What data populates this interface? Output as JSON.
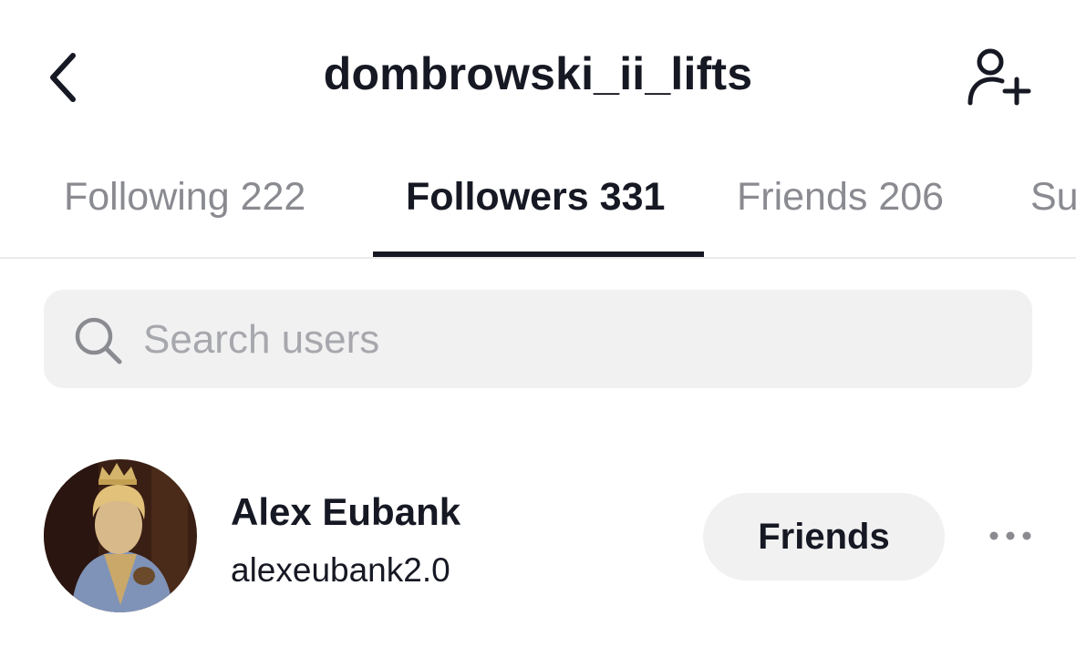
{
  "header": {
    "title": "dombrowski_ii_lifts",
    "back_icon": "chevron-left-icon",
    "add_icon": "add-user-icon"
  },
  "tabs": [
    {
      "label": "Following 222",
      "active": false
    },
    {
      "label": "Followers 331",
      "active": true
    },
    {
      "label": "Friends 206",
      "active": false
    },
    {
      "label": "Su",
      "active": false
    }
  ],
  "search": {
    "placeholder": "Search users",
    "value": "",
    "icon": "search-icon"
  },
  "users": [
    {
      "name": "Alex Eubank",
      "handle": "alexeubank2.0",
      "button_label": "Friends",
      "more_icon": "more-horizontal-icon"
    }
  ],
  "colors": {
    "text_primary": "#161823",
    "text_secondary": "#8a8b91",
    "placeholder": "#a7a8ad",
    "surface": "#f1f1f2",
    "divider": "#ebebeb"
  }
}
